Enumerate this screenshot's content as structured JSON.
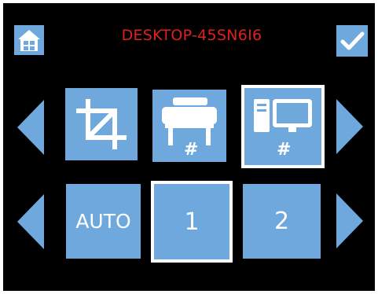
{
  "header": {
    "title": "DESKTOP-45SN6I6"
  },
  "row1": {
    "printer_badge": "#",
    "computer_badge": "#"
  },
  "row2": {
    "auto_label": "AUTO",
    "option_1": "1",
    "option_2": "2"
  },
  "colors": {
    "accent": "#6fa8dc",
    "title": "#e0201b",
    "background": "#000000",
    "selection": "#ffffff"
  }
}
